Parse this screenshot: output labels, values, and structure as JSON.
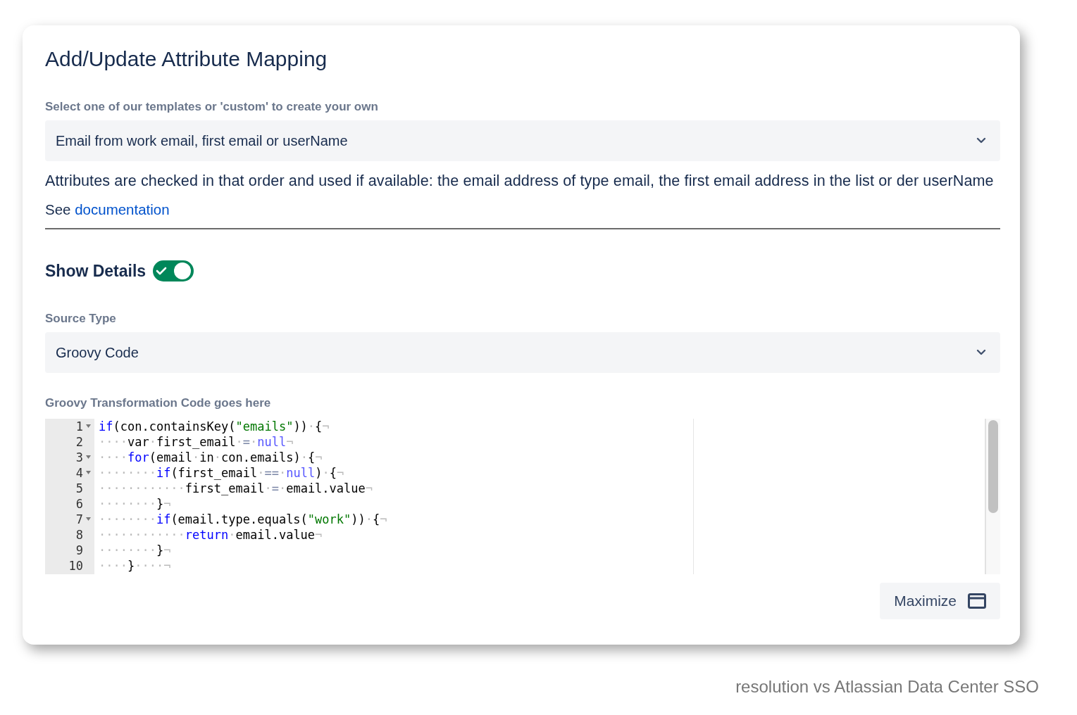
{
  "dialog": {
    "title": "Add/Update Attribute Mapping"
  },
  "template": {
    "label": "Select one of our templates or 'custom' to create your own",
    "value": "Email from work email, first email or userName",
    "description": "Attributes are checked in that order and used if available: the email address of type email, the first email address in the list or der userName",
    "see_text": "See",
    "link": "documentation"
  },
  "show_details": {
    "label": "Show Details",
    "on": true
  },
  "source_type": {
    "label": "Source Type",
    "value": "Groovy Code"
  },
  "code": {
    "label": "Groovy Transformation Code goes here",
    "lines": [
      {
        "number": "1",
        "foldable": true,
        "tokens": [
          {
            "kind": "keyword",
            "text": "if"
          },
          {
            "kind": "plain",
            "text": "(con.containsKey("
          },
          {
            "kind": "string",
            "text": "\"emails\""
          },
          {
            "kind": "plain",
            "text": "))"
          },
          {
            "kind": "space",
            "text": "·"
          },
          {
            "kind": "plain",
            "text": "{"
          },
          {
            "kind": "space",
            "text": "¬"
          }
        ]
      },
      {
        "number": "2",
        "foldable": false,
        "tokens": [
          {
            "kind": "space",
            "text": "····"
          },
          {
            "kind": "plain",
            "text": "var"
          },
          {
            "kind": "space",
            "text": "·"
          },
          {
            "kind": "plain",
            "text": "first_email"
          },
          {
            "kind": "space",
            "text": "·"
          },
          {
            "kind": "operator",
            "text": "="
          },
          {
            "kind": "space",
            "text": "·"
          },
          {
            "kind": "constant",
            "text": "null"
          },
          {
            "kind": "space",
            "text": "¬"
          }
        ]
      },
      {
        "number": "3",
        "foldable": true,
        "tokens": [
          {
            "kind": "space",
            "text": "····"
          },
          {
            "kind": "keyword",
            "text": "for"
          },
          {
            "kind": "plain",
            "text": "(email"
          },
          {
            "kind": "space",
            "text": "·"
          },
          {
            "kind": "plain",
            "text": "in"
          },
          {
            "kind": "space",
            "text": "·"
          },
          {
            "kind": "plain",
            "text": "con.emails)"
          },
          {
            "kind": "space",
            "text": "·"
          },
          {
            "kind": "plain",
            "text": "{"
          },
          {
            "kind": "space",
            "text": "¬"
          }
        ]
      },
      {
        "number": "4",
        "foldable": true,
        "tokens": [
          {
            "kind": "space",
            "text": "········"
          },
          {
            "kind": "keyword",
            "text": "if"
          },
          {
            "kind": "plain",
            "text": "(first_email"
          },
          {
            "kind": "space",
            "text": "·"
          },
          {
            "kind": "operator",
            "text": "=="
          },
          {
            "kind": "space",
            "text": "·"
          },
          {
            "kind": "constant",
            "text": "null"
          },
          {
            "kind": "plain",
            "text": ")"
          },
          {
            "kind": "space",
            "text": "·"
          },
          {
            "kind": "plain",
            "text": "{"
          },
          {
            "kind": "space",
            "text": "¬"
          }
        ]
      },
      {
        "number": "5",
        "foldable": false,
        "tokens": [
          {
            "kind": "space",
            "text": "············"
          },
          {
            "kind": "plain",
            "text": "first_email"
          },
          {
            "kind": "space",
            "text": "·"
          },
          {
            "kind": "operator",
            "text": "="
          },
          {
            "kind": "space",
            "text": "·"
          },
          {
            "kind": "plain",
            "text": "email.value"
          },
          {
            "kind": "space",
            "text": "¬"
          }
        ]
      },
      {
        "number": "6",
        "foldable": false,
        "tokens": [
          {
            "kind": "space",
            "text": "········"
          },
          {
            "kind": "plain",
            "text": "}"
          },
          {
            "kind": "space",
            "text": "¬"
          }
        ]
      },
      {
        "number": "7",
        "foldable": true,
        "tokens": [
          {
            "kind": "space",
            "text": "········"
          },
          {
            "kind": "keyword",
            "text": "if"
          },
          {
            "kind": "plain",
            "text": "(email.type.equals("
          },
          {
            "kind": "string",
            "text": "\"work\""
          },
          {
            "kind": "plain",
            "text": "))"
          },
          {
            "kind": "space",
            "text": "·"
          },
          {
            "kind": "plain",
            "text": "{"
          },
          {
            "kind": "space",
            "text": "¬"
          }
        ]
      },
      {
        "number": "8",
        "foldable": false,
        "tokens": [
          {
            "kind": "space",
            "text": "············"
          },
          {
            "kind": "keyword",
            "text": "return"
          },
          {
            "kind": "space",
            "text": "·"
          },
          {
            "kind": "plain",
            "text": "email.value"
          },
          {
            "kind": "space",
            "text": "¬"
          }
        ]
      },
      {
        "number": "9",
        "foldable": false,
        "tokens": [
          {
            "kind": "space",
            "text": "········"
          },
          {
            "kind": "plain",
            "text": "}"
          },
          {
            "kind": "space",
            "text": "¬"
          }
        ]
      },
      {
        "number": "10",
        "foldable": false,
        "tokens": [
          {
            "kind": "space",
            "text": "····"
          },
          {
            "kind": "plain",
            "text": "}"
          },
          {
            "kind": "space",
            "text": "····¬"
          }
        ]
      }
    ]
  },
  "maximize_button": "Maximize",
  "caption": "resolution vs Atlassian Data Center SSO"
}
